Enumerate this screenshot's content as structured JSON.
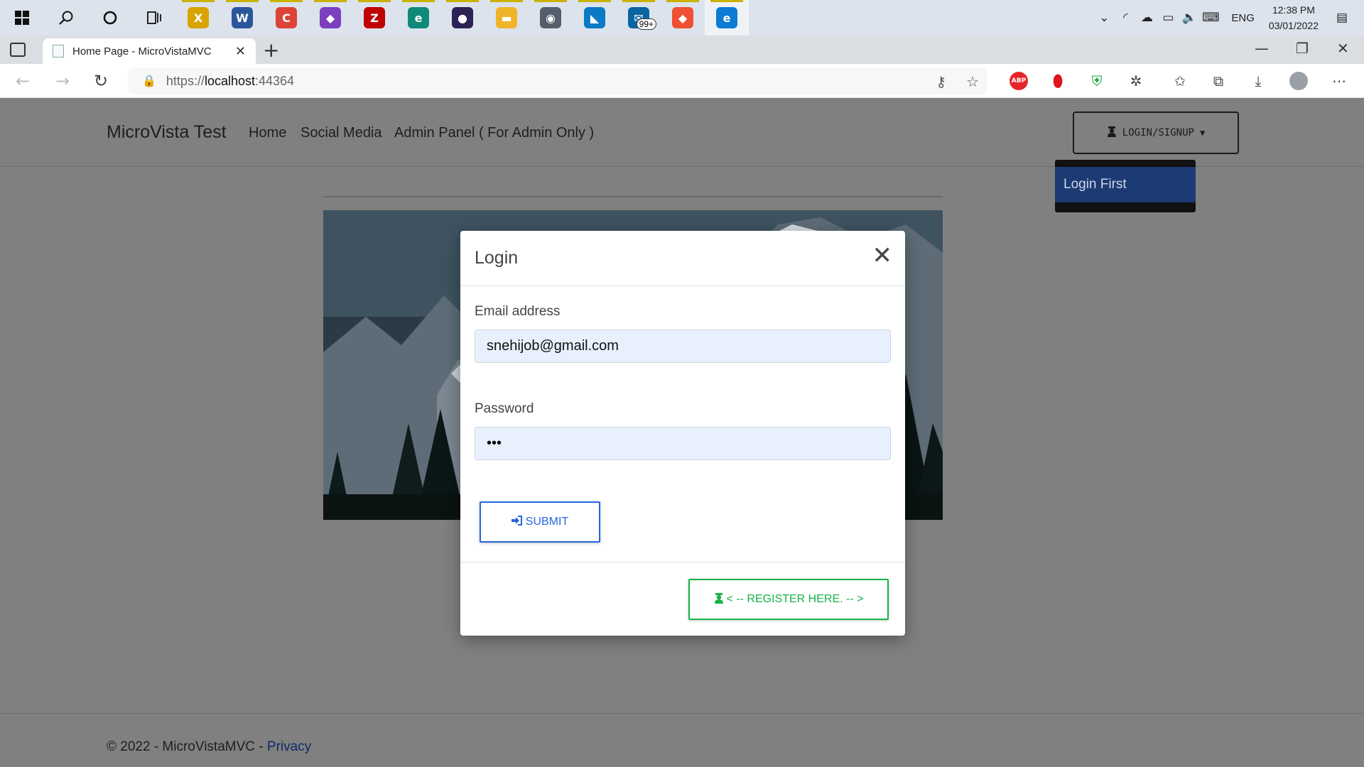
{
  "taskbar": {
    "start_icon": "windows-start-icon",
    "search_icon": "search-icon",
    "cortana_icon": "cortana-icon",
    "taskview_icon": "task-view-icon",
    "apps": [
      {
        "name": "app-ic-xmind",
        "label": "X",
        "color": "#d9a400"
      },
      {
        "name": "word",
        "label": "W",
        "color": "#2b579a"
      },
      {
        "name": "chrome",
        "label": "C",
        "color": "#db4437"
      },
      {
        "name": "visual-studio",
        "label": "◆",
        "color": "#7b3fbf"
      },
      {
        "name": "filezilla",
        "label": "Z",
        "color": "#bf0000"
      },
      {
        "name": "edge-dev",
        "label": "e",
        "color": "#0f8a7a"
      },
      {
        "name": "eclipse",
        "label": "●",
        "color": "#2c2255"
      },
      {
        "name": "file-explorer",
        "label": "▬",
        "color": "#f0b429"
      },
      {
        "name": "camera",
        "label": "◉",
        "color": "#555e6b"
      },
      {
        "name": "vscode",
        "label": "◣",
        "color": "#0a7ac7"
      },
      {
        "name": "mail",
        "label": "✉",
        "color": "#0a64a4",
        "badge": "99+"
      },
      {
        "name": "git",
        "label": "◆",
        "color": "#f05033"
      },
      {
        "name": "edge",
        "label": "e",
        "color": "#0c7cd5"
      }
    ],
    "tray": {
      "lang": "ENG",
      "time": "12:38 PM",
      "date": "03/01/2022"
    }
  },
  "browser": {
    "tab_title": "Home Page - MicroVistaMVC",
    "tab_close": "✕",
    "new_tab": "+",
    "url_scheme": "https://",
    "url_host": "localhost",
    "url_port": ":44364"
  },
  "site": {
    "brand": "MicroVista Test",
    "nav": [
      "Home",
      "Social Media",
      "Admin Panel ( For Admin Only )"
    ],
    "login_button": "LOGIN/SIGNUP",
    "dropdown_item": "Login First",
    "footer_copy": "© 2022 - MicroVistaMVC - ",
    "footer_link": "Privacy"
  },
  "modal": {
    "title": "Login",
    "close": "✕",
    "email_label": "Email address",
    "email_value": "snehijob@gmail.com",
    "password_label": "Password",
    "password_value": "•••",
    "submit": "SUBMIT",
    "register": "< -- REGISTER HERE. -- >"
  }
}
